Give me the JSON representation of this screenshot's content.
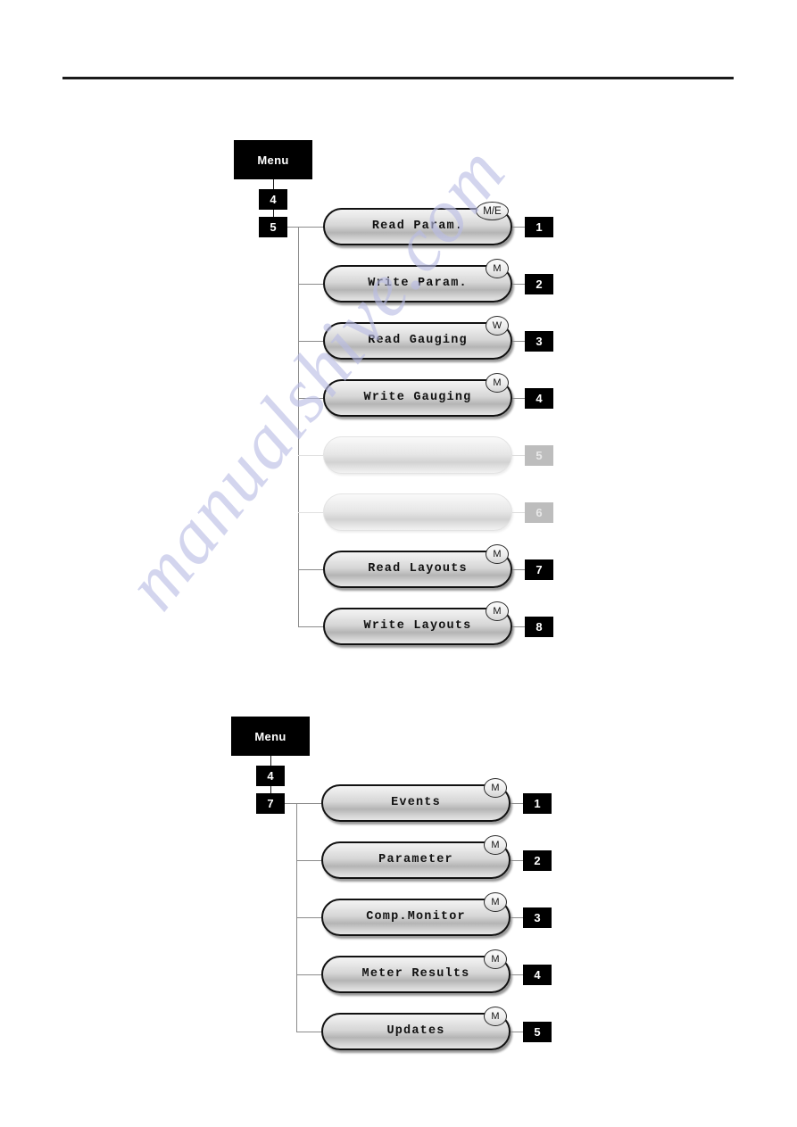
{
  "page": {
    "watermark_text": "manualshive.com",
    "watermark_color": "#b9bce4"
  },
  "diagrams": [
    {
      "id": "menu-tree-5",
      "menu_label": "Menu",
      "key_path": [
        "4",
        "5"
      ],
      "items": [
        {
          "label": "Read Param.",
          "badge": "M/E",
          "number": "1",
          "enabled": true
        },
        {
          "label": "Write Param.",
          "badge": "M",
          "number": "2",
          "enabled": true
        },
        {
          "label": "Read Gauging",
          "badge": "W",
          "number": "3",
          "enabled": true
        },
        {
          "label": "Write Gauging",
          "badge": "M",
          "number": "4",
          "enabled": true
        },
        {
          "label": "",
          "badge": "",
          "number": "5",
          "enabled": false
        },
        {
          "label": "",
          "badge": "",
          "number": "6",
          "enabled": false
        },
        {
          "label": "Read Layouts",
          "badge": "M",
          "number": "7",
          "enabled": true
        },
        {
          "label": "Write Layouts",
          "badge": "M",
          "number": "8",
          "enabled": true
        }
      ]
    },
    {
      "id": "menu-tree-7",
      "menu_label": "Menu",
      "key_path": [
        "4",
        "7"
      ],
      "items": [
        {
          "label": "Events",
          "badge": "M",
          "number": "1",
          "enabled": true
        },
        {
          "label": "Parameter",
          "badge": "M",
          "number": "2",
          "enabled": true
        },
        {
          "label": "Comp.Monitor",
          "badge": "M",
          "number": "3",
          "enabled": true
        },
        {
          "label": "Meter Results",
          "badge": "M",
          "number": "4",
          "enabled": true
        },
        {
          "label": "Updates",
          "badge": "M",
          "number": "5",
          "enabled": true
        }
      ]
    }
  ]
}
